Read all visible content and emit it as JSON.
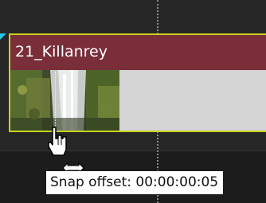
{
  "clip": {
    "title": "21_Killanrey"
  },
  "tooltip": {
    "text": "Snap offset: 00:00:00:05"
  },
  "icons": {
    "cursor": "hand-pointer-icon",
    "resize": "horizontal-resize-arrow-icon"
  },
  "colors": {
    "clip_header": "#7a2e3a",
    "clip_border_selected": "#c8d11e",
    "clip_body": "#d5d5d5",
    "start_marker": "#27c7e8",
    "background": "#1c1c1c"
  }
}
